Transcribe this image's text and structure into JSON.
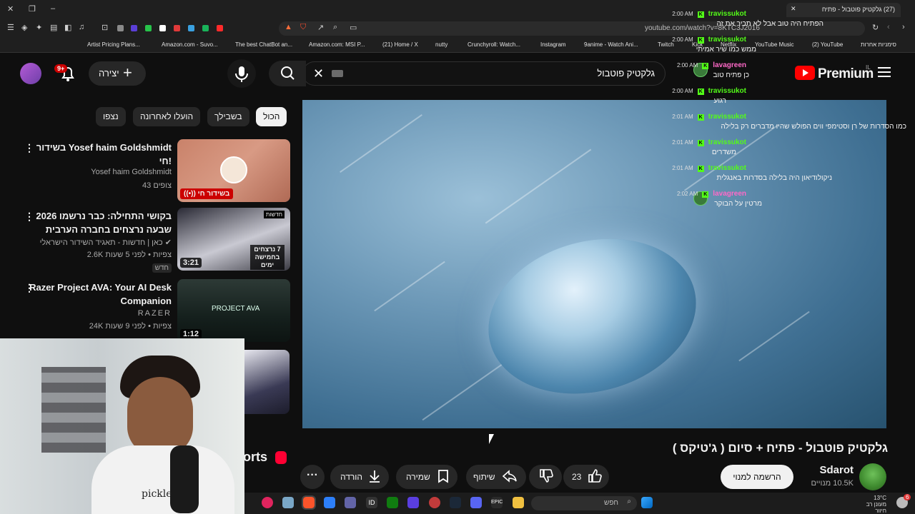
{
  "browser": {
    "tab_title": "(27) גלקטיק פוטבול - פתיח",
    "url": "youtube.com/watch?v=8KTC3J2016",
    "bookmarks": [
      "Artist Pricing Plans...",
      "Amazon.com - Suvo...",
      "The best ChatBot an...",
      "Amazon.com: MSI P...",
      "(21) Home / X",
      "nutty",
      "Crunchyroll: Watch...",
      "Instagram",
      "9anime - Watch Ani...",
      "Twitch",
      "Kick",
      "Netflix",
      "YouTube Music",
      "(2) YouTube",
      "סימניות אחרות"
    ]
  },
  "header": {
    "logo_word": "Premium",
    "logo_region": "IL",
    "search_query": "גלקטיק פוטבול",
    "create_label": "יצירה",
    "notification_count": "9+"
  },
  "chips": [
    "הכול",
    "בשבילך",
    "הועלו לאחרונה",
    "נצפו"
  ],
  "chat": [
    {
      "time": "2:00 AM",
      "user": "travissukot",
      "user_color": "#53fc18",
      "text": "הפתיח היה טוב אבל לא תכיר את זה",
      "text_top": "הפתיח היה טוב"
    },
    {
      "time": "2:00 AM",
      "user": "travissukot",
      "user_color": "#53fc18",
      "text": "ממש כמו שיר אמיתי"
    },
    {
      "time": "2:00 AM",
      "user": "lavagreen",
      "user_color": "#ff69c8",
      "text": "כן פתיח טוב"
    },
    {
      "time": "2:00 AM",
      "user": "travissukot",
      "user_color": "#53fc18",
      "text": "רגוע"
    },
    {
      "time": "2:01 AM",
      "user": "travissukot",
      "user_color": "#53fc18",
      "text": "כמו הסדרות של רן וסטימפי ווים הפולש שהיו מדברים רק בלילה"
    },
    {
      "time": "2:01 AM",
      "user": "travissukot",
      "user_color": "#53fc18",
      "text": "משדרים"
    },
    {
      "time": "2:01 AM",
      "user": "travissukot",
      "user_color": "#53fc18",
      "text": "ניקולודיאון היה בלילה בסדרות באנגלית"
    },
    {
      "time": "2:02 AM",
      "user": "lavagreen",
      "user_color": "#ff69c8",
      "text": "מרטין על הבוקר"
    }
  ],
  "video": {
    "title": "גלקטיק פוטבול - פתיח + סיום ( ג'טיקס )",
    "channel": "Sdarot",
    "subscribers": "10.5K מנויים",
    "subscribe_label": "הרשמה למנוי",
    "likes": "23",
    "share_label": "שיתוף",
    "save_label": "שמירה",
    "download_label": "הורדה"
  },
  "recommendations": [
    {
      "title": "בשידור Yosef haim Goldshmidt חי!",
      "channel": "Yosef haim Goldshmidt",
      "meta": "43 צופים",
      "badge": "בשידור חי",
      "badge_type": "live"
    },
    {
      "title": "2026 בקושי התחילה: כבר נרשמו שבעה נרצחים בחברה הערבית",
      "channel": "כאן | חדשות - תאגיד השידור הישראלי",
      "meta": "2.6K צפיות • לפני 5 שעות",
      "tag": "חדש",
      "badge": "3:21",
      "badge_type": "duration",
      "thumb_text": "7 נרצחים בחמישה ימים",
      "thumb_corner": "חדשות"
    },
    {
      "title": "Razer Project AVA: Your AI Desk Companion",
      "channel": "RAZER",
      "meta": "24K צפיות • לפני 9 שעות",
      "badge": "1:12",
      "badge_type": "duration",
      "thumb_text": "PROJECT AVA"
    }
  ],
  "shorts_label": "orts",
  "webcam": {
    "shirt_text": "pickle"
  },
  "taskbar": {
    "search_placeholder": "חפש",
    "weather_temp": "13°C",
    "weather_desc": "מעונן רב חיוור",
    "notif_count": "6"
  },
  "colors": {
    "accent_red": "#ff0000",
    "kick_green": "#53fc18",
    "bg": "#0f0f0f",
    "chip_bg": "#272727"
  }
}
